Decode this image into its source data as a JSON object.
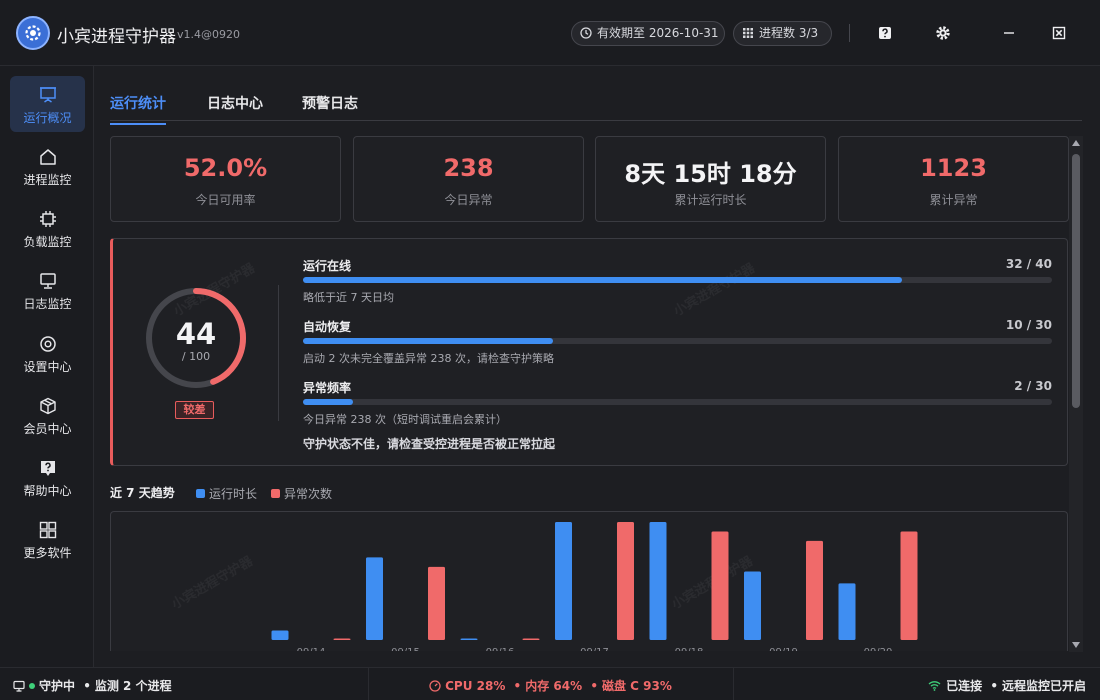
{
  "app": {
    "title": "小宾进程守护器",
    "version": "v1.4@0920",
    "expire_pill": "有效期至 2026-10-31",
    "process_pill": "进程数 3/3"
  },
  "sidebar": {
    "items": [
      {
        "label": "运行概况",
        "icon": "monitor-icon",
        "active": true
      },
      {
        "label": "进程监控",
        "icon": "home-icon"
      },
      {
        "label": "负载监控",
        "icon": "cpu-icon"
      },
      {
        "label": "日志监控",
        "icon": "display-icon"
      },
      {
        "label": "设置中心",
        "icon": "settings-icon"
      },
      {
        "label": "会员中心",
        "icon": "box-icon"
      },
      {
        "label": "帮助中心",
        "icon": "help-icon"
      },
      {
        "label": "更多软件",
        "icon": "apps-icon"
      }
    ]
  },
  "tabs": [
    "运行统计",
    "日志中心",
    "预警日志"
  ],
  "stats": [
    {
      "value": "52.0%",
      "label": "今日可用率",
      "color": "#f06a6a"
    },
    {
      "value": "238",
      "label": "今日异常",
      "color": "#f06a6a"
    },
    {
      "value": "8天 15时 18分",
      "label": "累计运行时长",
      "color": "#f4f4f6"
    },
    {
      "value": "1123",
      "label": "累计异常",
      "color": "#f06a6a"
    }
  ],
  "health": {
    "score": 44,
    "score_text": "44",
    "max_text": "/ 100",
    "max": 100,
    "grade": "较差",
    "metrics": [
      {
        "name": "运行在线",
        "value_text": "32 / 40",
        "value": 32,
        "max": 40,
        "desc": "略低于近 7 天日均"
      },
      {
        "name": "自动恢复",
        "value_text": "10 / 30",
        "value": 10,
        "max": 30,
        "desc": "启动 2 次未完全覆盖异常 238 次，请检查守护策略"
      },
      {
        "name": "异常频率",
        "value_text": "2 / 30",
        "value": 2,
        "max": 30,
        "desc": "今日异常 238 次（短时调试重启会累计）"
      }
    ],
    "note": "守护状态不佳，请检查受控进程是否被正常拉起",
    "watermark": "小宾进程守护器"
  },
  "trend": {
    "title": "近 7 天趋势",
    "legend": [
      "运行时长",
      "异常次数"
    ]
  },
  "chart_data": {
    "type": "bar",
    "categories": [
      "09/14",
      "09/15",
      "09/16",
      "09/17",
      "09/18",
      "09/19",
      "09/20"
    ],
    "series": [
      {
        "name": "运行时长",
        "color": "#3f8ef2",
        "values": [
          8,
          70,
          1,
          100,
          100,
          58,
          48
        ]
      },
      {
        "name": "异常次数",
        "color": "#f06a6a",
        "values": [
          0,
          62,
          1,
          100,
          92,
          84,
          92
        ]
      }
    ],
    "ylim": [
      0,
      100
    ]
  },
  "statusbar": {
    "left_state": "守护中",
    "left_detail": "监测 2 个进程",
    "cpu": "CPU 28%",
    "mem": "内存 64%",
    "disk": "磁盘 C 93%",
    "right_state": "已连接",
    "right_detail": "远程监控已开启",
    "separator": "•"
  }
}
